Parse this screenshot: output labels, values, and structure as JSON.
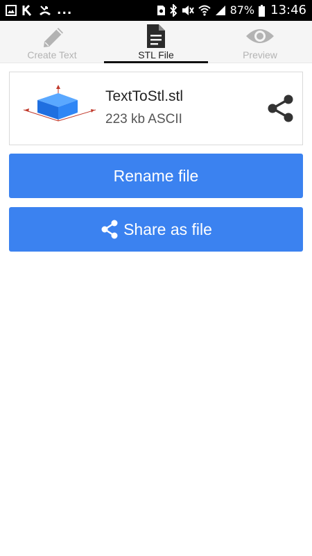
{
  "status_bar": {
    "icons_left": [
      "image-icon",
      "k-app-icon",
      "missed-call-icon"
    ],
    "overflow": "...",
    "icons_right": [
      "sim-icon",
      "bluetooth-icon",
      "mute-icon",
      "wifi-icon",
      "signal-icon",
      "battery-icon"
    ],
    "battery": "87%",
    "time": "13:46"
  },
  "tabs": [
    {
      "label": "Create Text",
      "icon": "pencil-icon",
      "active": false
    },
    {
      "label": "STL File",
      "icon": "document-icon",
      "active": true
    },
    {
      "label": "Preview",
      "icon": "eye-icon",
      "active": false
    }
  ],
  "file": {
    "name": "TextToStl.stl",
    "meta": "223 kb ASCII",
    "thumbnail_icon": "3d-box-icon",
    "share_icon": "share-icon"
  },
  "actions": {
    "rename_label": "Rename file",
    "share_label": "Share as file"
  },
  "colors": {
    "accent": "#3b82f0",
    "status_bar": "#000000",
    "tab_bar": "#f5f5f5",
    "inactive_tab": "#b3b3b3"
  }
}
